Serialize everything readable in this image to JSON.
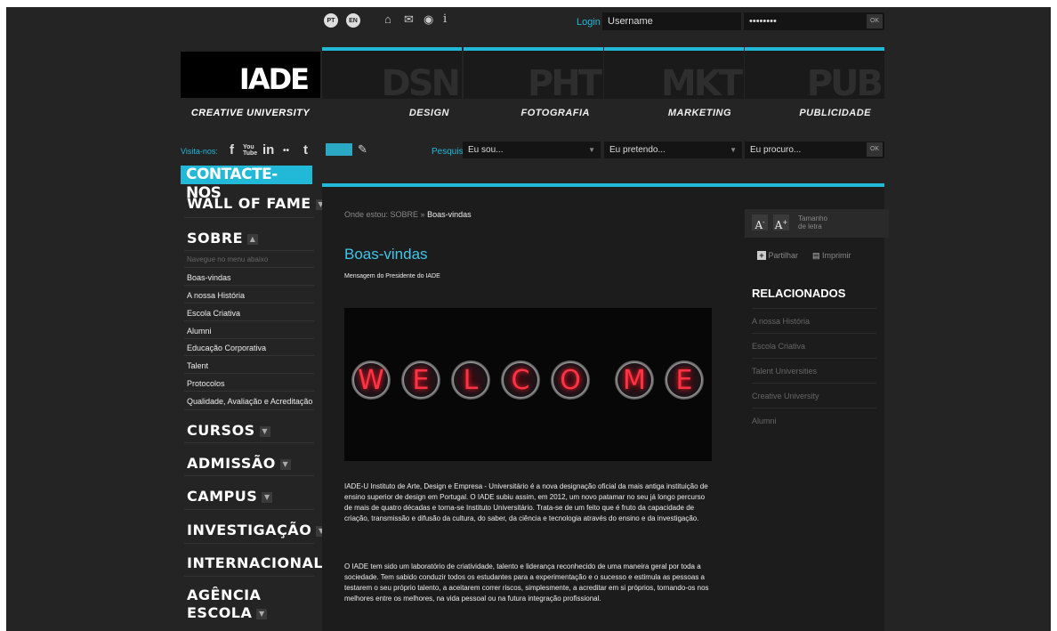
{
  "topbar": {
    "langs": [
      "PT",
      "EN"
    ],
    "icons": [
      "home-icon",
      "mail-icon",
      "chat-icon",
      "info-icon"
    ],
    "info_glyph": "i",
    "login_label": "Login",
    "username": "Username",
    "password": "••••••••",
    "ok": "OK"
  },
  "brand": {
    "logo": "IADE",
    "tagline": "CREATIVE UNIVERSITY"
  },
  "nav": [
    {
      "ghost": "DSN",
      "label": "DESIGN"
    },
    {
      "ghost": "PHT",
      "label": "FOTOGRAFIA"
    },
    {
      "ghost": "MKT",
      "label": "MARKETING"
    },
    {
      "ghost": "PUB",
      "label": "PUBLICIDADE"
    }
  ],
  "social": {
    "visit_label": "Visita-nos:",
    "items": [
      "f",
      "You Tube",
      "in",
      "••",
      "t"
    ]
  },
  "search": {
    "label": "Pesquisar:",
    "selects": [
      "Eu sou...",
      "Eu pretendo...",
      "Eu procuro..."
    ],
    "ok": "OK"
  },
  "sidebar": {
    "contact": "CONTACTE-NOS",
    "wall": "WALL OF FAME",
    "sobre": "SOBRE",
    "note": "Navegue no menu abaixo",
    "sublinks": [
      "Boas-vindas",
      "A nossa História",
      "Escola Criativa",
      "Alumni",
      "Educação Corporativa",
      "Talent",
      "Protocolos",
      "Qualidade, Avaliação e Acreditação"
    ],
    "sections": [
      "CURSOS",
      "ADMISSÃO",
      "CAMPUS",
      "INVESTIGAÇÃO",
      "INTERNACIONAL"
    ],
    "agencia_1": "AGÊNCIA",
    "agencia_2": "ESCOLA"
  },
  "content": {
    "crumb_prefix": "Onde estou:  SOBRE  »",
    "crumb_current": "Boas-vindas",
    "title": "Boas-vindas",
    "subtitle": "Mensagem do Presidente do IADE",
    "welcome_letters": [
      "W",
      "E",
      "L",
      "C",
      "O",
      "M",
      "E"
    ],
    "para1": "IADE-U Instituto de Arte, Design e Empresa - Universitário é a nova designação oficial da mais antiga instituição de ensino superior de design em Portugal. O IADE subiu assim, em 2012, um novo patamar no seu já longo percurso de mais de quatro décadas e torna-se Instituto Universitário. Trata-se de um feito que é fruto da capacidade de criação, transmissão e difusão da cultura, do saber, da ciência e tecnologia através do ensino e da investigação.",
    "para2": "O IADE tem sido um laboratório de criatividade, talento e liderança reconhecido de uma maneira geral por toda a sociedade. Tem sabido conduzir todos os estudantes para a experimentação e o sucesso e estimula as pessoas a testarem o seu próprio talento, a aceitarem correr riscos, simplesmente, a acreditar em si próprios, tornando-os nos melhores entre os melhores, na vida pessoal ou na futura integração profissional."
  },
  "right": {
    "font_minus": "A",
    "font_plus": "A",
    "font_label_1": "Tamanho",
    "font_label_2": "de letra",
    "share": "Partilhar",
    "print": "Imprimir",
    "related_title": "RELACIONADOS",
    "related": [
      "A nossa História",
      "Escola Criativa",
      "Talent Universities",
      "Creative University",
      "Alumni"
    ]
  },
  "colors": {
    "accent": "#22b8d8",
    "background": "#242424",
    "panel": "#1c1c1c"
  }
}
